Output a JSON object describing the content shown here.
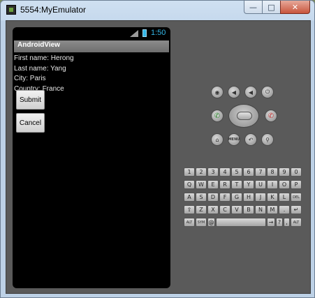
{
  "window": {
    "title": "5554:MyEmulator",
    "minimize_glyph": "—",
    "maximize_glyph": "□",
    "close_glyph": "✕"
  },
  "statusbar": {
    "signal_label": "3G",
    "time": "1:50"
  },
  "app": {
    "title": "AndroidView",
    "fields": [
      "First name: Herong",
      "Last name: Yang",
      "City: Paris",
      "Country: France"
    ],
    "submit_label": "Submit",
    "cancel_label": "Cancel"
  },
  "controls": {
    "camera_icon": "camera-icon",
    "volume_down_icon": "volume-down-icon",
    "volume_up_icon": "volume-up-icon",
    "power_icon": "power-icon",
    "call_icon": "call-icon",
    "end_call_icon": "end-call-icon",
    "home_icon": "home-icon",
    "menu_label": "MENU",
    "back_icon": "back-icon",
    "search_icon": "search-icon"
  },
  "keyboard": {
    "row1": [
      "1",
      "2",
      "3",
      "4",
      "5",
      "6",
      "7",
      "8",
      "9",
      "0"
    ],
    "row2": [
      "Q",
      "W",
      "E",
      "R",
      "T",
      "Y",
      "U",
      "I",
      "O",
      "P"
    ],
    "row3": [
      "A",
      "S",
      "D",
      "F",
      "G",
      "H",
      "J",
      "K",
      "L",
      "DEL"
    ],
    "row4": [
      "⇧",
      "Z",
      "X",
      "C",
      "V",
      "B",
      "N",
      "M",
      ".",
      "↵"
    ],
    "row5": [
      "ALT",
      "SYM",
      "@",
      "",
      "→",
      "?",
      ",",
      "ALT"
    ]
  }
}
